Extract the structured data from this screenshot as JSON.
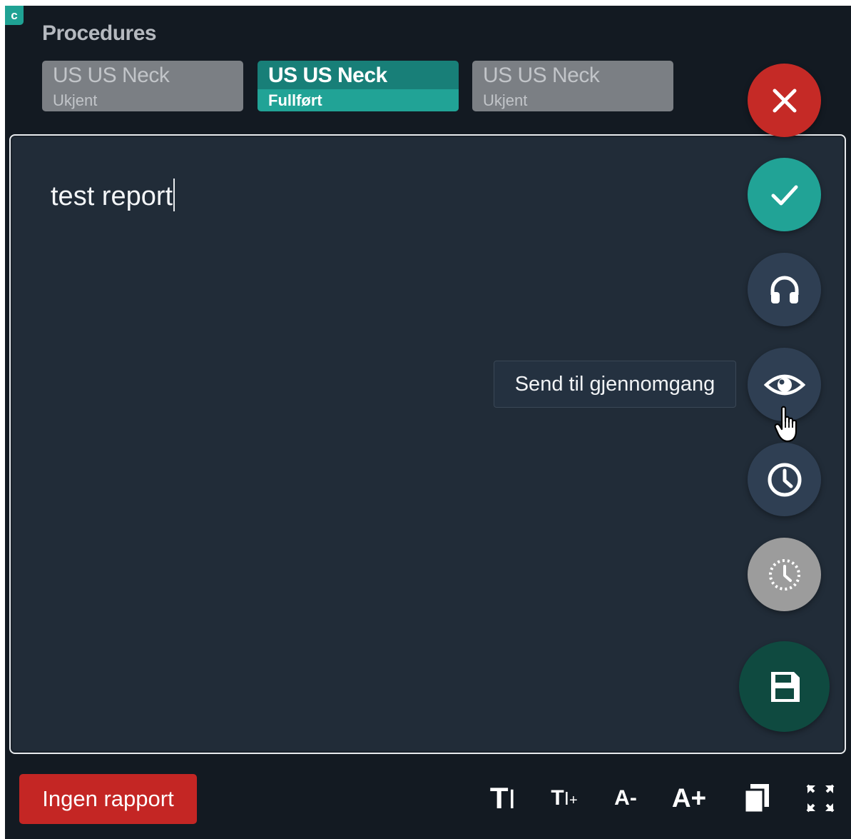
{
  "badge": "c",
  "procedures": {
    "title": "Procedures",
    "tabs": [
      {
        "name": "US US Neck",
        "status": "Ukjent",
        "state": "inactive"
      },
      {
        "name": "US US Neck",
        "status": "Fullført",
        "state": "active"
      },
      {
        "name": "US US Neck",
        "status": "Ukjent",
        "state": "inactive"
      }
    ]
  },
  "editor": {
    "text": "test report"
  },
  "actions": {
    "close": "close-icon",
    "approve": "check-icon",
    "dictation": "headphones-icon",
    "review": "eye-icon",
    "schedule": "clock-icon",
    "scheduled_disabled": "dotted-clock-icon",
    "save": "floppy-disk-icon"
  },
  "tooltip": {
    "text": "Send til gjennomgang"
  },
  "bottom": {
    "no_report_label": "Ingen rapport",
    "tools": {
      "text_size": "T",
      "text_size_plus": "T",
      "font_smaller": "A-",
      "font_larger": "A+"
    }
  },
  "colors": {
    "background": "#131a22",
    "editor_bg": "#212c38",
    "accent_teal": "#21a396",
    "danger_red": "#c52a26",
    "fab_dark": "#2f3f53",
    "save_green": "#0f4a40"
  }
}
